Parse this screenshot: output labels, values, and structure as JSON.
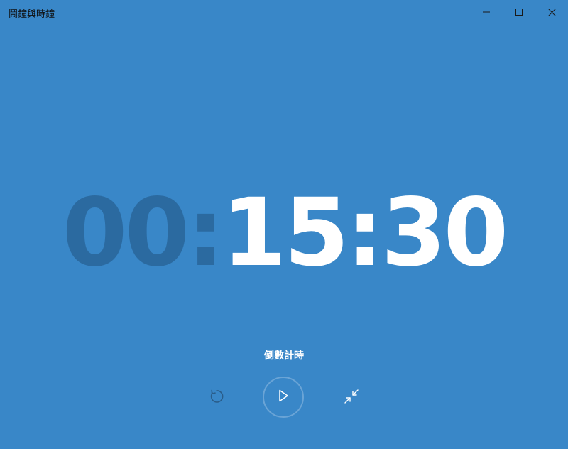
{
  "window": {
    "title": "鬧鐘與時鐘",
    "background": "#3987c8"
  },
  "titlebar": {
    "minimize_icon": "minimize-icon",
    "maximize_icon": "maximize-icon",
    "close_icon": "close-icon"
  },
  "timer": {
    "hours": "00",
    "sep1": ":",
    "minutes": "15",
    "sep2": ":",
    "seconds": "30",
    "dim_color": "#2b6aa0",
    "bright_color": "#ffffff"
  },
  "mode": {
    "label": "倒數計時"
  },
  "controls": {
    "reset_icon": "reset-icon",
    "play_icon": "play-icon",
    "compact_icon": "compact-overlay-icon"
  }
}
